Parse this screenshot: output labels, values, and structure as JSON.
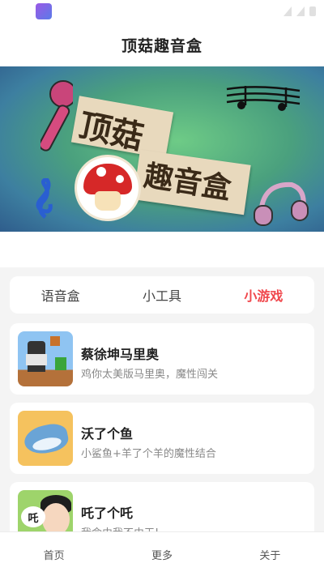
{
  "app": {
    "title": "顶菇趣音盒"
  },
  "banner": {
    "line1": "顶菇",
    "line2": "趣音盒"
  },
  "tabs": [
    {
      "label": "语音盒",
      "active": false
    },
    {
      "label": "小工具",
      "active": false
    },
    {
      "label": "小游戏",
      "active": true
    }
  ],
  "games": [
    {
      "name": "蔡徐坤马里奥",
      "desc": "鸡你太美版马里奥，魔性闯关",
      "icon": "mario-thumb-icon"
    },
    {
      "name": "沃了个鱼",
      "desc": "小鲨鱼+羊了个羊的魔性结合",
      "icon": "shark-thumb-icon"
    },
    {
      "name": "吒了个吒",
      "desc": "我命由我不由天!",
      "icon": "nezha-thumb-icon",
      "bubble": "吒"
    }
  ],
  "bottom_nav": [
    {
      "label": "首页"
    },
    {
      "label": "更多"
    },
    {
      "label": "关于"
    }
  ],
  "colors": {
    "accent": "#f0464b",
    "background": "#f4f4f4"
  }
}
